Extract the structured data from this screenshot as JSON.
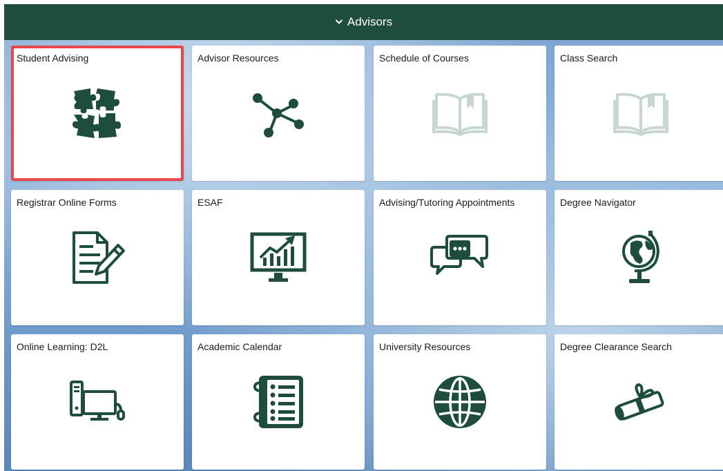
{
  "header": {
    "title": "Advisors"
  },
  "colors": {
    "header_bg": "#1f4d3d",
    "icon": "#1f4d3d",
    "icon_disabled": "#c7d6d0",
    "selected_border": "#e8474b"
  },
  "tiles": [
    {
      "label": "Student Advising",
      "icon": "puzzle-icon",
      "selected": true
    },
    {
      "label": "Advisor Resources",
      "icon": "network-icon"
    },
    {
      "label": "Schedule of Courses",
      "icon": "open-book-icon"
    },
    {
      "label": "Class Search",
      "icon": "open-book-icon"
    },
    {
      "label": "Registrar Online Forms",
      "icon": "document-edit-icon"
    },
    {
      "label": "ESAF",
      "icon": "monitor-chart-icon"
    },
    {
      "label": "Advising/Tutoring Appointments",
      "icon": "chat-bubbles-icon"
    },
    {
      "label": "Degree Navigator",
      "icon": "globe-stand-icon"
    },
    {
      "label": "Online Learning: D2L",
      "icon": "computer-icon"
    },
    {
      "label": "Academic Calendar",
      "icon": "notebook-list-icon"
    },
    {
      "label": "University Resources",
      "icon": "world-icon"
    },
    {
      "label": "Degree Clearance Search",
      "icon": "diploma-icon"
    }
  ]
}
